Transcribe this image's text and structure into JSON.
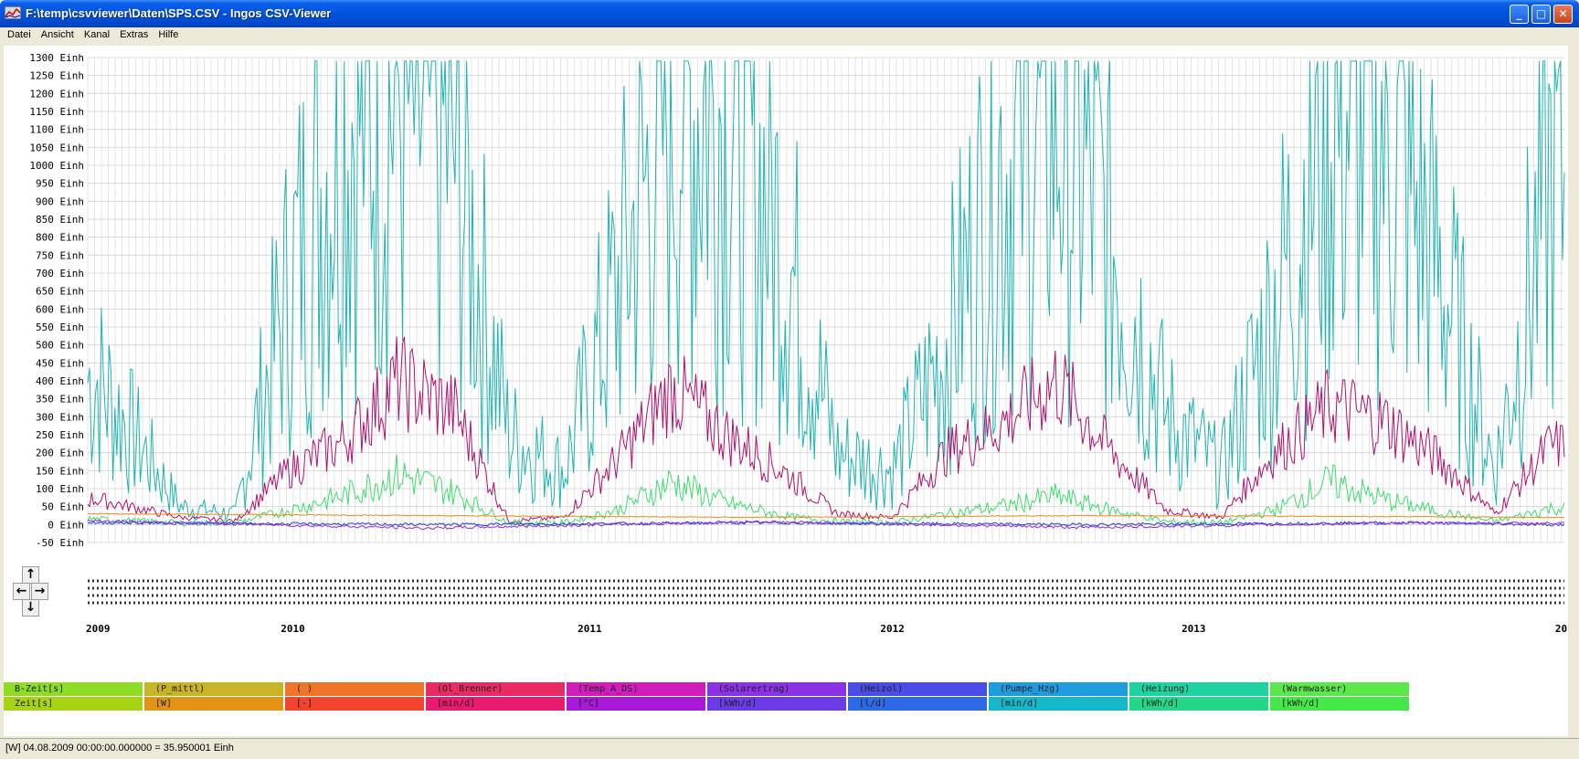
{
  "window": {
    "title": "F:\\temp\\csvviewer\\Daten\\SPS.CSV - Ingos CSV-Viewer",
    "buttons": {
      "minimize": "_",
      "maximize": "□",
      "close": "✕"
    }
  },
  "menu": [
    "Datei",
    "Ansicht",
    "Kanal",
    "Extras",
    "Hilfe"
  ],
  "colors": {
    "teal": "#1fb3b3",
    "magenta": "#b0106e",
    "green": "#3ddc6c",
    "orange": "#e88a14",
    "blue": "#2a3ccf",
    "purple": "#8a2be2",
    "grid": "#d2d2d2",
    "axis_text": "#000000"
  },
  "chart_data": {
    "type": "line",
    "y_unit": "Einh",
    "y_ticks": [
      "1300 Einh",
      "1250 Einh",
      "1200 Einh",
      "1150 Einh",
      "1100 Einh",
      "1050 Einh",
      "1000 Einh",
      "950 Einh",
      "900 Einh",
      "850 Einh",
      "800 Einh",
      "750 Einh",
      "700 Einh",
      "650 Einh",
      "600 Einh",
      "550 Einh",
      "500 Einh",
      "450 Einh",
      "400 Einh",
      "350 Einh",
      "300 Einh",
      "250 Einh",
      "200 Einh",
      "150 Einh",
      "100 Einh",
      "50 Einh",
      "0 Einh",
      "-50 Einh"
    ],
    "ylim": [
      -50,
      1300
    ],
    "x_ticks": [
      "2009",
      "2010",
      "2011",
      "2012",
      "2013",
      "20"
    ],
    "x_range": [
      "2009-08-04",
      "2014-01-31"
    ],
    "grid": true,
    "series": [
      {
        "color": "#1fb3b3",
        "x": [
          "2009-08",
          "2009-11",
          "2010-01",
          "2010-03",
          "2010-05",
          "2010-07",
          "2010-09",
          "2010-11",
          "2011-01",
          "2011-03",
          "2011-05",
          "2011-07",
          "2011-09",
          "2011-11",
          "2012-01",
          "2012-03",
          "2012-05",
          "2012-07",
          "2012-09",
          "2012-11",
          "2013-01",
          "2013-03",
          "2013-05",
          "2013-07",
          "2013-09",
          "2013-11",
          "2014-01"
        ],
        "values": [
          400,
          50,
          30,
          650,
          1150,
          1200,
          1050,
          250,
          150,
          650,
          1200,
          1180,
          800,
          200,
          150,
          500,
          1000,
          1150,
          800,
          300,
          150,
          600,
          1150,
          1100,
          700,
          150,
          950
        ]
      },
      {
        "color": "#b0106e",
        "x": [
          "2009-08",
          "2009-11",
          "2010-01",
          "2010-03",
          "2010-05",
          "2010-07",
          "2010-09",
          "2010-11",
          "2011-01",
          "2011-03",
          "2011-05",
          "2011-07",
          "2011-09",
          "2011-11",
          "2012-01",
          "2012-03",
          "2012-05",
          "2012-07",
          "2012-09",
          "2012-11",
          "2013-01",
          "2013-03",
          "2013-05",
          "2013-07",
          "2013-09",
          "2013-11",
          "2014-01"
        ],
        "values": [
          70,
          20,
          10,
          150,
          230,
          400,
          320,
          10,
          20,
          180,
          380,
          250,
          150,
          30,
          20,
          200,
          280,
          400,
          200,
          40,
          20,
          200,
          330,
          290,
          180,
          30,
          220
        ]
      },
      {
        "color": "#3ddc6c",
        "x": [
          "2009-08",
          "2009-11",
          "2010-01",
          "2010-03",
          "2010-05",
          "2010-07",
          "2010-09",
          "2010-11",
          "2011-01",
          "2011-03",
          "2011-05",
          "2011-07",
          "2011-09",
          "2011-11",
          "2012-01",
          "2012-03",
          "2012-05",
          "2012-07",
          "2012-09",
          "2012-11",
          "2013-01",
          "2013-03",
          "2013-05",
          "2013-07",
          "2013-09",
          "2013-11",
          "2014-01"
        ],
        "values": [
          15,
          5,
          5,
          40,
          80,
          140,
          90,
          5,
          5,
          40,
          120,
          60,
          25,
          8,
          5,
          30,
          50,
          80,
          40,
          8,
          5,
          40,
          120,
          70,
          35,
          8,
          45
        ]
      },
      {
        "color": "#e88a14",
        "x": [
          "2009-08",
          "2010-08",
          "2011-08",
          "2012-08",
          "2013-08",
          "2014-01"
        ],
        "values": [
          30,
          25,
          20,
          25,
          22,
          20
        ]
      },
      {
        "color": "#2a3ccf",
        "x": [
          "2009-08",
          "2010-08",
          "2011-08",
          "2012-08",
          "2013-08",
          "2014-01"
        ],
        "values": [
          5,
          0,
          5,
          0,
          5,
          0
        ]
      },
      {
        "color": "#8a2be2",
        "x": [
          "2009-08",
          "2010-08",
          "2011-08",
          "2012-08",
          "2013-08",
          "2014-01"
        ],
        "values": [
          10,
          -10,
          8,
          -8,
          5,
          3
        ]
      }
    ]
  },
  "legend": {
    "row1": [
      {
        "label": "B-Zeit[s]",
        "color": "#8fdc26"
      },
      {
        "label": "(P_mittl)",
        "color": "#c8b426"
      },
      {
        "label": "(         )",
        "color": "#ef7426"
      },
      {
        "label": "(Ol_Brenner)",
        "color": "#ea2a63"
      },
      {
        "label": "(Temp_A_DS)",
        "color": "#d21cbc"
      },
      {
        "label": "(Solarertrag)",
        "color": "#8b32e6"
      },
      {
        "label": "(Heizol)",
        "color": "#4a4ce8"
      },
      {
        "label": "(Pumpe_Hzg)",
        "color": "#1d9ce0"
      },
      {
        "label": "(Heizung)",
        "color": "#1ed3a0"
      },
      {
        "label": "(Warmwasser)",
        "color": "#5ae84a"
      }
    ],
    "row2": [
      {
        "label": "Zeit[s]",
        "color": "#a6d414"
      },
      {
        "label": "[W]",
        "color": "#e39414"
      },
      {
        "label": "[-]",
        "color": "#f2442f"
      },
      {
        "label": "[min/d]",
        "color": "#ea1a6e"
      },
      {
        "label": "[°C]",
        "color": "#a91ad8"
      },
      {
        "label": "[kWh/d]",
        "color": "#6c3ae6"
      },
      {
        "label": "[l/d]",
        "color": "#2d6ae8"
      },
      {
        "label": "[min/d]",
        "color": "#14b8c8"
      },
      {
        "label": "[kWh/d]",
        "color": "#22d888"
      },
      {
        "label": "[kWh/d]",
        "color": "#44e848"
      }
    ]
  },
  "status": "[W] 04.08.2009 00:00:00.000000 = 35.950001 Einh"
}
